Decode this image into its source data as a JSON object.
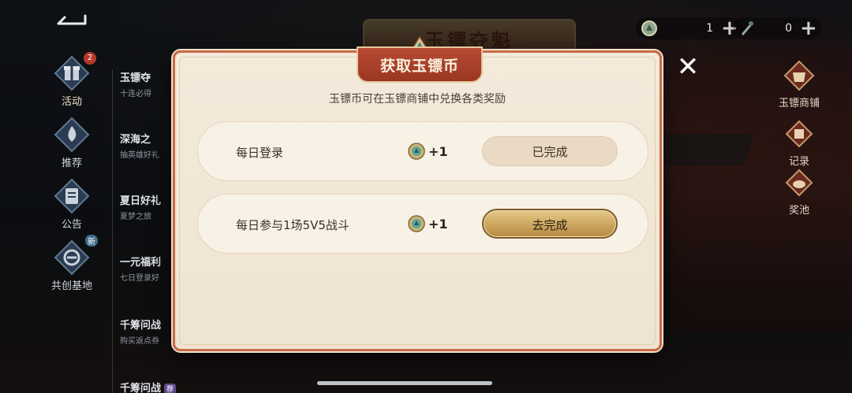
{
  "topbar": {
    "currencies": [
      {
        "icon": "jade-coin-icon",
        "value": "1"
      },
      {
        "icon": "dart-token-icon",
        "value": "0"
      }
    ],
    "plus_label": "+"
  },
  "background": {
    "banner_title": "玉镖夺魁"
  },
  "sidebar": {
    "items": [
      {
        "label": "活动",
        "badge": "2",
        "icon": "gift-icon"
      },
      {
        "label": "推荐",
        "icon": "flame-icon"
      },
      {
        "label": "公告",
        "icon": "notice-icon"
      },
      {
        "label": "共创基地",
        "badge": "新",
        "icon": "co-create-icon"
      }
    ]
  },
  "subnav": {
    "items": [
      {
        "title": "玉镖夺",
        "desc": "十连必得"
      },
      {
        "title": "深海之",
        "desc": "抽英雄好礼"
      },
      {
        "title": "夏日好礼",
        "desc": "夏梦之旅"
      },
      {
        "title": "一元福利",
        "desc": "七日登录好"
      },
      {
        "title": "千筹问战",
        "desc": "购买返点券"
      },
      {
        "title": "千筹问战",
        "desc": "",
        "tag": "荐"
      }
    ]
  },
  "right_menu": {
    "items": [
      {
        "label": "玉镖商铺",
        "icon": "shop-icon"
      },
      {
        "label": "记录",
        "icon": "record-icon"
      },
      {
        "label": "奖池",
        "icon": "prize-pool-icon"
      }
    ]
  },
  "dialog": {
    "title": "获取玉镖币",
    "subtitle": "玉镖币可在玉镖商铺中兑换各类奖励",
    "tasks": [
      {
        "name": "每日登录",
        "reward": "+1",
        "button": "已完成",
        "state": "done"
      },
      {
        "name": "每日参与1场5V5战斗",
        "reward": "+1",
        "button": "去完成",
        "state": "go"
      }
    ],
    "close_label": "✕"
  },
  "colors": {
    "dialog_bg": "#f3eadb",
    "dialog_border": "#c96a4a",
    "title_bar": "#b84b34",
    "gold_button": "#c9a25a"
  }
}
